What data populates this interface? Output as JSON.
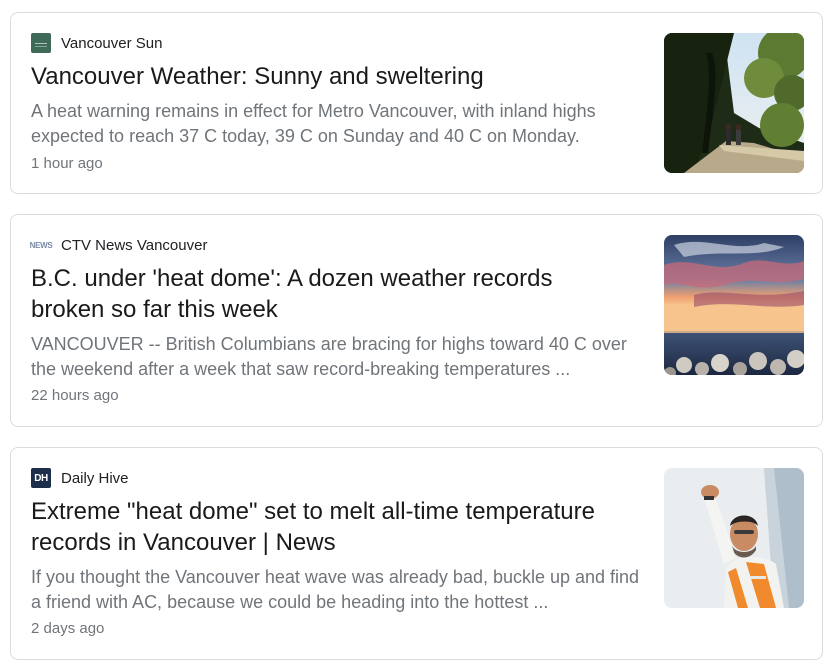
{
  "articles": [
    {
      "source": "Vancouver Sun",
      "source_icon": "vancouver-sun-logo-icon",
      "title": "Vancouver Weather: Sunny and sweltering",
      "snippet": "A heat warning remains in effect for Metro Vancouver, with inland highs expected to reach 37 C today, 39 C on Sunday and 40 C on Monday.",
      "time": "1 hour ago",
      "thumbnail": "walkers-on-tree-lined-path"
    },
    {
      "source": "CTV News Vancouver",
      "source_icon": "ctv-news-logo-icon",
      "source_icon_text": "NEWS",
      "title": "B.C. under 'heat dome': A dozen weather records broken so far this week",
      "snippet": "VANCOUVER -- British Columbians are bracing for highs toward 40 C over the weekend after a week that saw record-breaking temperatures ...",
      "time": "22 hours ago",
      "thumbnail": "sunset-over-ocean-with-rocks"
    },
    {
      "source": "Daily Hive",
      "source_icon": "daily-hive-logo-icon",
      "source_icon_text": "DH",
      "title": "Extreme \"heat dome\" set to melt all-time temperature records in Vancouver | News",
      "snippet": "If you thought the Vancouver heat wave was already bad, buckle up and find a friend with AC, because we could be heading into the hottest ...",
      "time": "2 days ago",
      "thumbnail": "worker-shading-eyes-from-sun"
    }
  ],
  "colors": {
    "title": "#1a1a1a",
    "snippet": "#70757a",
    "border": "#dadce0"
  }
}
